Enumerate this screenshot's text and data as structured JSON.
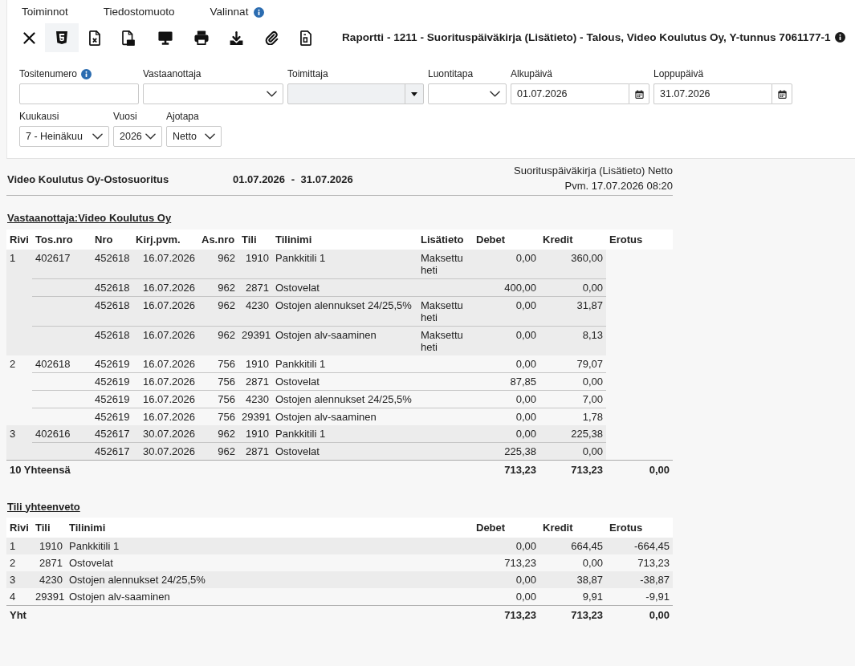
{
  "menu": [
    {
      "label": "Toiminnot",
      "info": false
    },
    {
      "label": "Tiedostomuoto",
      "info": false
    },
    {
      "label": "Valinnat",
      "info": true
    }
  ],
  "toolbar": [
    {
      "kind": "close",
      "selected": false
    },
    {
      "kind": "html",
      "selected": true
    },
    {
      "kind": "excel",
      "selected": false
    },
    {
      "kind": "pdf",
      "selected": false
    },
    {
      "kind": "screen",
      "selected": false
    },
    {
      "kind": "print",
      "selected": false
    },
    {
      "kind": "download",
      "selected": false
    },
    {
      "kind": "attachment",
      "selected": false
    },
    {
      "kind": "file",
      "selected": false
    }
  ],
  "report_title": {
    "text": "Raportti - 1211 - Suorituspäiväkirja (Lisätieto) - Talous, Video Koulutus Oy, Y-tunnus 7061177-1",
    "info": true
  },
  "filters": [
    {
      "label": "Tositenumero",
      "kind": "text",
      "info": true,
      "disabled": false
    },
    {
      "label": "Vastaanottaja",
      "kind": "select",
      "info": false,
      "disabled": false
    },
    {
      "label": "Toimittaja",
      "kind": "combo",
      "info": false,
      "disabled": true
    },
    {
      "label": "Luontitapa",
      "kind": "select",
      "info": false,
      "disabled": false
    },
    {
      "label": "Alkupäivä",
      "kind": "date",
      "info": false,
      "disabled": false,
      "value": "01.07.2026"
    },
    {
      "label": "Loppupäivä",
      "kind": "date",
      "info": false,
      "disabled": false,
      "value": "31.07.2026"
    },
    {
      "label": "Kuukausi",
      "kind": "select",
      "info": false,
      "disabled": false,
      "value": "7 - Heinäkuu"
    },
    {
      "label": "Vuosi",
      "kind": "select",
      "info": false,
      "disabled": false,
      "value": "2026"
    },
    {
      "label": "Ajotapa",
      "kind": "select",
      "info": false,
      "disabled": false,
      "value": "Netto"
    }
  ],
  "report": {
    "header": {
      "company": "Video Koulutus Oy-Ostosuoritus",
      "period": "01.07.2026 - 31.07.2026",
      "report_name": "Suorituspäiväkirja (Lisätieto) Netto",
      "printed": "Pvm. 17.07.2026 08:20"
    },
    "recipient_heading": "Vastaanottaja:Video Koulutus Oy",
    "table": {
      "columns": [
        "Rivi",
        "Tos.nro",
        "Nro",
        "Kirj.pvm.",
        "As.nro",
        "Tili",
        "Tilinimi",
        "Lisätieto",
        "Debet",
        "Kredit",
        "Erotus"
      ],
      "groups": [
        {
          "rivi": "1",
          "tos_nro": "402617",
          "entries": [
            {
              "nro": "452618",
              "kirj_pvm": "16.07.2026",
              "as_nro": "962",
              "tili": "1910",
              "tilinimi": "Pankkitili 1",
              "lisatieto": "Maksettu heti",
              "debet": "0,00",
              "kredit": "360,00"
            },
            {
              "nro": "452618",
              "kirj_pvm": "16.07.2026",
              "as_nro": "962",
              "tili": "2871",
              "tilinimi": "Ostovelat",
              "debet": "400,00",
              "kredit": "0,00"
            },
            {
              "nro": "452618",
              "kirj_pvm": "16.07.2026",
              "as_nro": "962",
              "tili": "4230",
              "tilinimi": "Ostojen alennukset 24/25,5%",
              "lisatieto": "Maksettu heti",
              "debet": "0,00",
              "kredit": "31,87"
            },
            {
              "nro": "452618",
              "kirj_pvm": "16.07.2026",
              "as_nro": "962",
              "tili": "29391",
              "tilinimi": "Ostojen alv-saaminen",
              "lisatieto": "Maksettu heti",
              "debet": "0,00",
              "kredit": "8,13"
            }
          ]
        },
        {
          "rivi": "2",
          "tos_nro": "402618",
          "entries": [
            {
              "nro": "452619",
              "kirj_pvm": "16.07.2026",
              "as_nro": "756",
              "tili": "1910",
              "tilinimi": "Pankkitili 1",
              "debet": "0,00",
              "kredit": "79,07"
            },
            {
              "nro": "452619",
              "kirj_pvm": "16.07.2026",
              "as_nro": "756",
              "tili": "2871",
              "tilinimi": "Ostovelat",
              "debet": "87,85",
              "kredit": "0,00"
            },
            {
              "nro": "452619",
              "kirj_pvm": "16.07.2026",
              "as_nro": "756",
              "tili": "4230",
              "tilinimi": "Ostojen alennukset 24/25,5%",
              "debet": "0,00",
              "kredit": "7,00"
            },
            {
              "nro": "452619",
              "kirj_pvm": "16.07.2026",
              "as_nro": "756",
              "tili": "29391",
              "tilinimi": "Ostojen alv-saaminen",
              "debet": "0,00",
              "kredit": "1,78"
            }
          ]
        },
        {
          "rivi": "3",
          "tos_nro": "402616",
          "entries": [
            {
              "nro": "452617",
              "kirj_pvm": "30.07.2026",
              "as_nro": "962",
              "tili": "1910",
              "tilinimi": "Pankkitili 1",
              "debet": "0,00",
              "kredit": "225,38"
            },
            {
              "nro": "452617",
              "kirj_pvm": "30.07.2026",
              "as_nro": "962",
              "tili": "2871",
              "tilinimi": "Ostovelat",
              "debet": "225,38",
              "kredit": "0,00"
            }
          ]
        }
      ],
      "total": {
        "label": "10 Yhteensä",
        "debet": "713,23",
        "kredit": "713,23",
        "erotus": "0,00"
      }
    },
    "summary": {
      "heading": "Tili yhteenveto",
      "columns": [
        "Rivi",
        "Tili",
        "Tilinimi",
        "Debet",
        "Kredit",
        "Erotus"
      ],
      "rows": [
        {
          "rivi": "1",
          "tili": "1910",
          "tilinimi": "Pankkitili 1",
          "debet": "0,00",
          "kredit": "664,45",
          "erotus": "-664,45"
        },
        {
          "rivi": "2",
          "tili": "2871",
          "tilinimi": "Ostovelat",
          "debet": "713,23",
          "kredit": "0,00",
          "erotus": "713,23"
        },
        {
          "rivi": "3",
          "tili": "4230",
          "tilinimi": "Ostojen alennukset 24/25,5%",
          "debet": "0,00",
          "kredit": "38,87",
          "erotus": "-38,87"
        },
        {
          "rivi": "4",
          "tili": "29391",
          "tilinimi": "Ostojen alv-saaminen",
          "debet": "0,00",
          "kredit": "9,91",
          "erotus": "-9,91"
        }
      ],
      "total": {
        "label": "Yht",
        "debet": "713,23",
        "kredit": "713,23",
        "erotus": "0,00"
      }
    }
  }
}
